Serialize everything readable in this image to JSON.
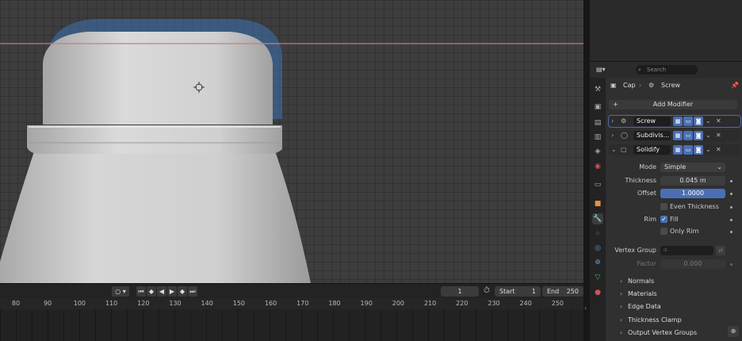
{
  "breadcrumb": {
    "object": "Cap",
    "modifier": "Screw"
  },
  "search": {
    "placeholder": "Search"
  },
  "add_modifier_label": "Add Modifier",
  "modifiers": [
    {
      "name": "Screw"
    },
    {
      "name": "Subdivis..."
    },
    {
      "name": "Solidify"
    }
  ],
  "solidify": {
    "mode_label": "Mode",
    "mode_value": "Simple",
    "thickness_label": "Thickness",
    "thickness_value": "0.045 m",
    "offset_label": "Offset",
    "offset_value": "1.0000",
    "even_thickness_label": "Even Thickness",
    "rim_label": "Rim",
    "fill_label": "Fill",
    "only_rim_label": "Only Rim",
    "vertex_group_label": "Vertex Group",
    "factor_label": "Factor",
    "factor_value": "0.000",
    "sections": [
      "Normals",
      "Materials",
      "Edge Data",
      "Thickness Clamp",
      "Output Vertex Groups"
    ]
  },
  "timeline": {
    "current_frame": "1",
    "start_label": "Start",
    "start_value": "1",
    "end_label": "End",
    "end_value": "250",
    "ruler": [
      "80",
      "90",
      "100",
      "110",
      "120",
      "130",
      "140",
      "150",
      "160",
      "170",
      "180",
      "190",
      "200",
      "210",
      "220",
      "230",
      "240",
      "250"
    ]
  },
  "colors": {
    "accent": "#4a6fb5",
    "panel": "#303030",
    "viewport": "#3d3d3d"
  }
}
